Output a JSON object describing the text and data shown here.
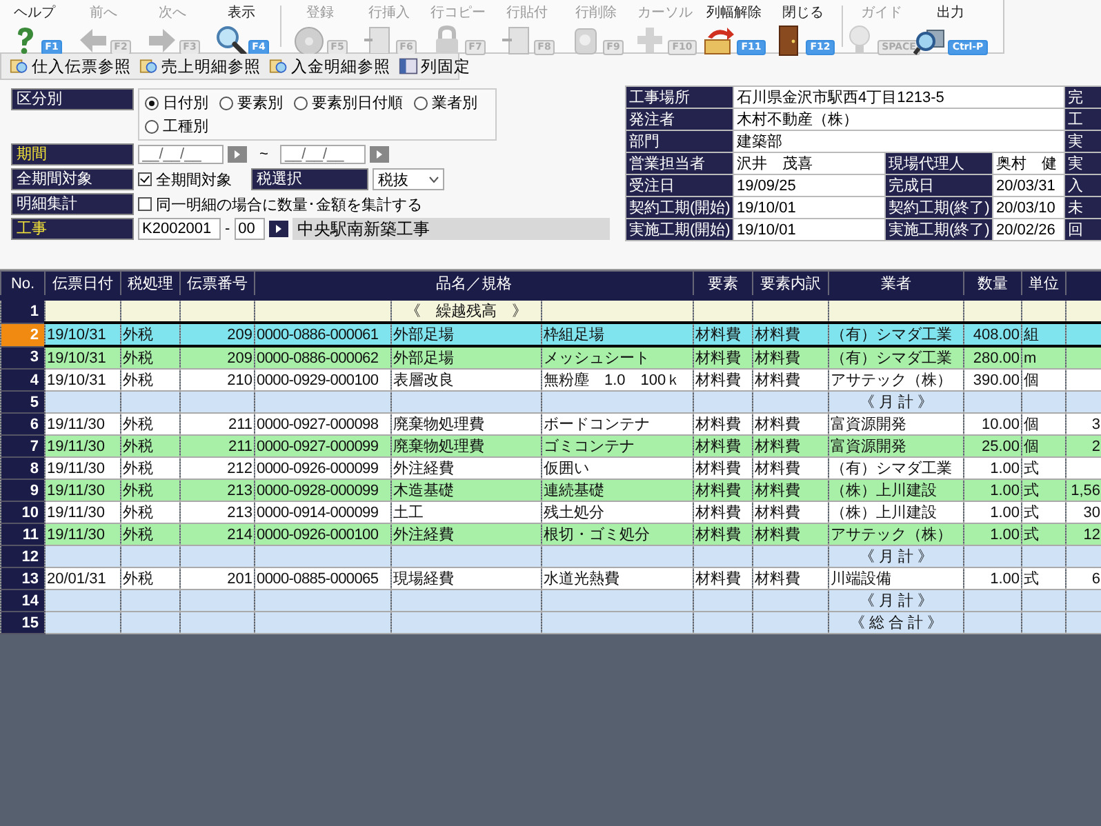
{
  "toolbar": [
    {
      "label": "ヘルプ",
      "key": "F1",
      "disabled": false,
      "separator_before": false
    },
    {
      "label": "前へ",
      "key": "F2",
      "disabled": true,
      "separator_before": false
    },
    {
      "label": "次へ",
      "key": "F3",
      "disabled": true,
      "separator_before": false
    },
    {
      "label": "表示",
      "key": "F4",
      "disabled": false,
      "separator_before": false
    },
    {
      "label": "登録",
      "key": "F5",
      "disabled": true,
      "separator_before": true
    },
    {
      "label": "行挿入",
      "key": "F6",
      "disabled": true,
      "separator_before": false
    },
    {
      "label": "行コピー",
      "key": "F7",
      "disabled": true,
      "separator_before": false
    },
    {
      "label": "行貼付",
      "key": "F8",
      "disabled": true,
      "separator_before": false
    },
    {
      "label": "行削除",
      "key": "F9",
      "disabled": true,
      "separator_before": false
    },
    {
      "label": "カーソル",
      "key": "F10",
      "disabled": true,
      "separator_before": false
    },
    {
      "label": "列幅解除",
      "key": "F11",
      "disabled": false,
      "separator_before": false
    },
    {
      "label": "閉じる",
      "key": "F12",
      "disabled": false,
      "separator_before": false
    },
    {
      "label": "ガイド",
      "key": "SPACE",
      "disabled": true,
      "separator_before": true
    },
    {
      "label": "出力",
      "key": "Ctrl-P",
      "disabled": false,
      "separator_before": false
    }
  ],
  "reference_buttons": [
    "仕入伝票参照",
    "売上明細参照",
    "入金明細参照",
    "列固定"
  ],
  "filter": {
    "grouping": {
      "label": "区分別",
      "required": false,
      "options": [
        {
          "label": "日付別",
          "selected": true
        },
        {
          "label": "要素別",
          "selected": false
        },
        {
          "label": "要素別日付順",
          "selected": false
        },
        {
          "label": "業者別",
          "selected": false
        },
        {
          "label": "工種別",
          "selected": false
        }
      ]
    },
    "period": {
      "label": "期間",
      "required": true,
      "from_placeholder": "__/__/__",
      "separator": "~",
      "to_placeholder": "__/__/__"
    },
    "all_period": {
      "label": "全期間対象",
      "required": false,
      "checkbox": "全期間対象",
      "checked": true,
      "tax_label": "税選択",
      "tax_value": "税抜"
    },
    "aggregate": {
      "label": "明細集計",
      "required": false,
      "checkbox": "同一明細の場合に数量･金額を集計する",
      "checked": false
    },
    "project": {
      "label": "工事",
      "required": true,
      "code": "K2002001",
      "dash": "-",
      "branch": "00",
      "name": "中央駅南新築工事"
    }
  },
  "info": [
    {
      "label": "工事場所",
      "value": "石川県金沢市駅西4丁目1213-5",
      "side_label": "完"
    },
    {
      "label": "発注者",
      "value": "木村不動産（株）",
      "side_label": "工"
    },
    {
      "label": "部門",
      "value": "建築部",
      "side_label": "実"
    },
    {
      "label": "営業担当者",
      "value": "沢井　茂喜",
      "label_2": "現場代理人",
      "value_2": "奥村　健",
      "side_label": "実"
    },
    {
      "label": "受注日",
      "value": "19/09/25",
      "label_2": "完成日",
      "value_2": "20/03/31",
      "side_label": "入"
    },
    {
      "label": "契約工期(開始)",
      "value": "19/10/01",
      "label_2": "契約工期(終了)",
      "value_2": "20/03/10",
      "side_label": "未"
    },
    {
      "label": "実施工期(開始)",
      "value": "19/10/01",
      "label_2": "実施工期(終了)",
      "value_2": "20/02/26",
      "side_label": "回"
    }
  ],
  "table": {
    "columns": [
      "No.",
      "伝票日付",
      "税処理",
      "伝票番号",
      "品名／規格",
      "要素",
      "要素内訳",
      "業者",
      "数量",
      "単位"
    ],
    "rows": [
      {
        "no": "1",
        "kind": "carry",
        "selected": false,
        "item": "《　繰越残高　》"
      },
      {
        "no": "2",
        "kind": "detail",
        "selected": true,
        "color": "#80e4ee",
        "date": "19/10/31",
        "tax": "外税",
        "slip_no": "209",
        "code": "0000-0886-000061",
        "item": "外部足場",
        "spec": "枠組足場",
        "element": "材料費",
        "element_detail": "材料費",
        "vendor": "（有）シマダ工業",
        "quantity": "408.00",
        "unit": "組"
      },
      {
        "no": "3",
        "kind": "detail",
        "selected": false,
        "color": "#a8f0a8",
        "date": "19/10/31",
        "tax": "外税",
        "slip_no": "209",
        "code": "0000-0886-000062",
        "item": "外部足場",
        "spec": "メッシュシート",
        "element": "材料費",
        "element_detail": "材料費",
        "vendor": "（有）シマダ工業",
        "quantity": "280.00",
        "unit": "m"
      },
      {
        "no": "4",
        "kind": "detail",
        "selected": false,
        "color": "#ffffff",
        "date": "19/10/31",
        "tax": "外税",
        "slip_no": "210",
        "code": "0000-0929-000100",
        "item": "表層改良",
        "spec": "無粉塵　1.0　100ｋ",
        "element": "材料費",
        "element_detail": "材料費",
        "vendor": "アサテック（株）",
        "quantity": "390.00",
        "unit": "個"
      },
      {
        "no": "5",
        "kind": "subtotal",
        "selected": false,
        "vendor": "《 月 計 》"
      },
      {
        "no": "6",
        "kind": "detail",
        "selected": false,
        "color": "#ffffff",
        "date": "19/11/30",
        "tax": "外税",
        "slip_no": "211",
        "code": "0000-0927-000098",
        "item": "廃棄物処理費",
        "spec": "ボードコンテナ",
        "element": "材料費",
        "element_detail": "材料費",
        "vendor": "富資源開発",
        "quantity": "10.00",
        "unit": "個",
        "column_12": "3"
      },
      {
        "no": "7",
        "kind": "detail",
        "selected": false,
        "color": "#a8f0a8",
        "date": "19/11/30",
        "tax": "外税",
        "slip_no": "211",
        "code": "0000-0927-000099",
        "item": "廃棄物処理費",
        "spec": "ゴミコンテナ",
        "element": "材料費",
        "element_detail": "材料費",
        "vendor": "富資源開発",
        "quantity": "25.00",
        "unit": "個",
        "column_12": "2"
      },
      {
        "no": "8",
        "kind": "detail",
        "selected": false,
        "color": "#ffffff",
        "date": "19/11/30",
        "tax": "外税",
        "slip_no": "212",
        "code": "0000-0926-000099",
        "item": "外注経費",
        "spec": "仮囲い",
        "element": "材料費",
        "element_detail": "材料費",
        "vendor": "（有）シマダ工業",
        "quantity": "1.00",
        "unit": "式"
      },
      {
        "no": "9",
        "kind": "detail",
        "selected": false,
        "color": "#a8f0a8",
        "date": "19/11/30",
        "tax": "外税",
        "slip_no": "213",
        "code": "0000-0928-000099",
        "item": "木造基礎",
        "spec": "連続基礎",
        "element": "材料費",
        "element_detail": "材料費",
        "vendor": "（株）上川建設",
        "quantity": "1.00",
        "unit": "式",
        "column_12": "1,56"
      },
      {
        "no": "10",
        "kind": "detail",
        "selected": false,
        "color": "#ffffff",
        "date": "19/11/30",
        "tax": "外税",
        "slip_no": "213",
        "code": "0000-0914-000099",
        "item": "土工",
        "spec": "残土処分",
        "element": "材料費",
        "element_detail": "材料費",
        "vendor": "（株）上川建設",
        "quantity": "1.00",
        "unit": "式",
        "column_12": "30"
      },
      {
        "no": "11",
        "kind": "detail",
        "selected": false,
        "color": "#a8f0a8",
        "date": "19/11/30",
        "tax": "外税",
        "slip_no": "214",
        "code": "0000-0926-000100",
        "item": "外注経費",
        "spec": "根切・ゴミ処分",
        "element": "材料費",
        "element_detail": "材料費",
        "vendor": "アサテック（株）",
        "quantity": "1.00",
        "unit": "式",
        "column_12": "12"
      },
      {
        "no": "12",
        "kind": "subtotal",
        "selected": false,
        "vendor": "《 月 計 》"
      },
      {
        "no": "13",
        "kind": "detail",
        "selected": false,
        "color": "#ffffff",
        "date": "20/01/31",
        "tax": "外税",
        "slip_no": "201",
        "code": "0000-0885-000065",
        "item": "現場経費",
        "spec": "水道光熱費",
        "element": "材料費",
        "element_detail": "材料費",
        "vendor": "川端設備",
        "quantity": "1.00",
        "unit": "式",
        "column_12": "6"
      },
      {
        "no": "14",
        "kind": "subtotal",
        "selected": false,
        "vendor": "《 月 計 》"
      },
      {
        "no": "15",
        "kind": "subtotal",
        "selected": false,
        "vendor": "《 総 合 計 》"
      }
    ]
  }
}
